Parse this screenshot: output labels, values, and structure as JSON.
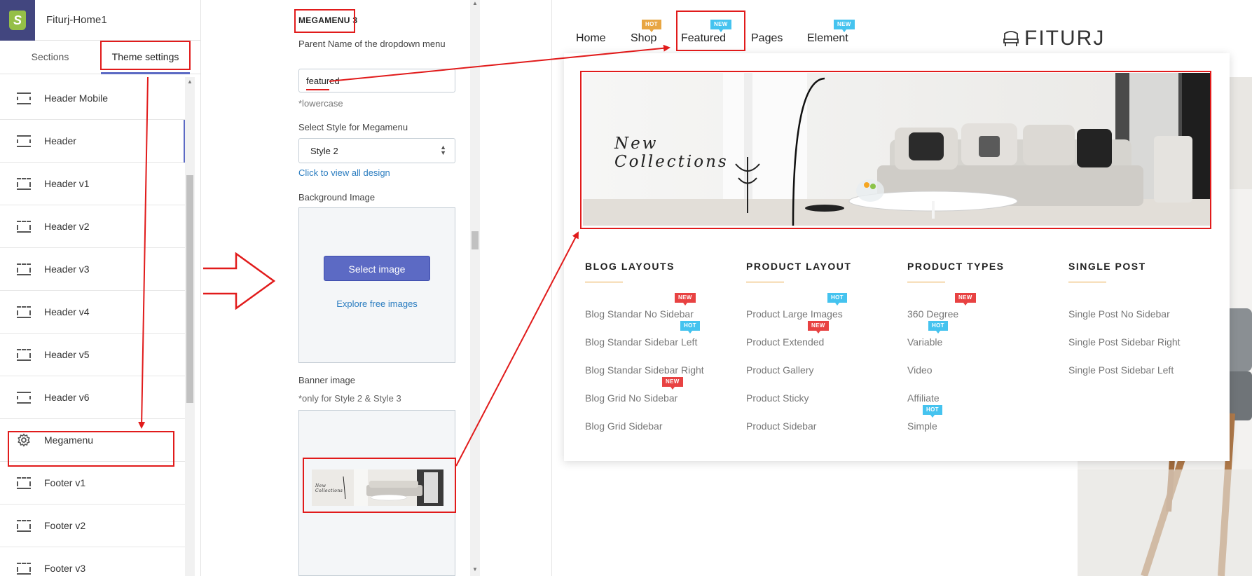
{
  "app": {
    "title": "Fiturj-Home1"
  },
  "tabs": {
    "sections": "Sections",
    "theme_settings": "Theme settings"
  },
  "sidebar": {
    "items": [
      {
        "label": "Header Mobile",
        "icon": "header-icon"
      },
      {
        "label": "Header",
        "icon": "header-icon"
      },
      {
        "label": "Header v1",
        "icon": "header-dashed-icon"
      },
      {
        "label": "Header v2",
        "icon": "header-dashed-icon"
      },
      {
        "label": "Header v3",
        "icon": "header-dashed-icon"
      },
      {
        "label": "Header v4",
        "icon": "header-dashed-icon"
      },
      {
        "label": "Header v5",
        "icon": "header-dashed-icon"
      },
      {
        "label": "Header v6",
        "icon": "header-icon"
      },
      {
        "label": "Megamenu",
        "icon": "gear-icon"
      },
      {
        "label": "Footer v1",
        "icon": "footer-dashed-icon"
      },
      {
        "label": "Footer v2",
        "icon": "footer-dashed-icon"
      },
      {
        "label": "Footer v3",
        "icon": "footer-dashed-icon"
      }
    ]
  },
  "settings": {
    "heading": "MEGAMENU 3",
    "parent_label": "Parent Name of the dropdown menu",
    "parent_value": "featured",
    "lowercase_note": "*lowercase",
    "style_label": "Select Style for Megamenu",
    "style_value": "Style 2",
    "view_design_link": "Click to view all design",
    "bg_label": "Background Image",
    "select_image_button": "Select image",
    "explore_link": "Explore free images",
    "banner_label": "Banner image",
    "banner_note": "*only for Style 2 & Style 3",
    "thumb_text_1": "New",
    "thumb_text_2": "Collections"
  },
  "store_nav": {
    "items": [
      {
        "label": "Home"
      },
      {
        "label": "Shop",
        "badge": "HOT"
      },
      {
        "label": "Featured",
        "badge": "NEW"
      },
      {
        "label": "Pages"
      },
      {
        "label": "Element",
        "badge": "NEW"
      }
    ],
    "brand": "FITURJ"
  },
  "megamenu": {
    "banner_text_1": "New",
    "banner_text_2": "Collections",
    "columns": [
      {
        "title": "BLOG LAYOUTS",
        "links": [
          {
            "label": "Blog Standar No Sidebar",
            "badge": "NEW"
          },
          {
            "label": "Blog Standar Sidebar Left",
            "badge": "HOT"
          },
          {
            "label": "Blog Standar Sidebar Right"
          },
          {
            "label": "Blog Grid No Sidebar",
            "badge": "NEW"
          },
          {
            "label": "Blog Grid Sidebar"
          }
        ]
      },
      {
        "title": "PRODUCT LAYOUT",
        "links": [
          {
            "label": "Product Large Images",
            "badge": "HOT"
          },
          {
            "label": "Product Extended",
            "badge": "NEW"
          },
          {
            "label": "Product Gallery"
          },
          {
            "label": "Product Sticky"
          },
          {
            "label": "Product Sidebar"
          }
        ]
      },
      {
        "title": "PRODUCT TYPES",
        "links": [
          {
            "label": "360 Degree",
            "badge": "NEW"
          },
          {
            "label": "Variable",
            "badge": "HOT"
          },
          {
            "label": "Video"
          },
          {
            "label": "Affiliate"
          },
          {
            "label": "Simple",
            "badge": "HOT"
          }
        ]
      },
      {
        "title": "SINGLE POST",
        "links": [
          {
            "label": "Single Post No Sidebar"
          },
          {
            "label": "Single Post Sidebar Right"
          },
          {
            "label": "Single Post Sidebar Left"
          }
        ]
      }
    ]
  },
  "colors": {
    "accent": "#5c6ac4",
    "annotation_red": "#e11b1b",
    "badge_hot_orange": "#e8a643",
    "badge_blue": "#45c3ef",
    "badge_red": "#e84242",
    "app_bar": "#42467f"
  }
}
